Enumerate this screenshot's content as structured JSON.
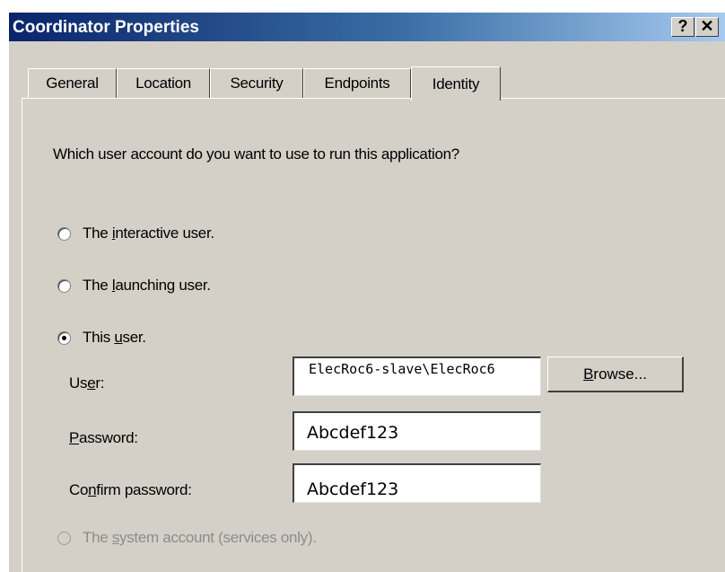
{
  "window": {
    "title": "Coordinator Properties",
    "help_label": "?",
    "close_label": "✕"
  },
  "tabs": [
    {
      "label": "General",
      "active": false
    },
    {
      "label": "Location",
      "active": false
    },
    {
      "label": "Security",
      "active": false
    },
    {
      "label": "Endpoints",
      "active": false
    },
    {
      "label": "Identity",
      "active": true
    }
  ],
  "identity": {
    "question": "Which user account do you want to use to run this application?",
    "options": [
      {
        "pre": "The ",
        "key": "i",
        "post": "nteractive user.",
        "selected": false,
        "enabled": true
      },
      {
        "pre": "The ",
        "key": "l",
        "post": "aunching user.",
        "selected": false,
        "enabled": true
      },
      {
        "pre": "This ",
        "key": "u",
        "post": "ser.",
        "selected": true,
        "enabled": true
      },
      {
        "pre": "The ",
        "key": "s",
        "post": "ystem account (services only).",
        "selected": false,
        "enabled": false
      }
    ],
    "user": {
      "label_pre": "Us",
      "label_key": "e",
      "label_post": "r:",
      "value": "ElecRoc6-slave\\ElecRoc6"
    },
    "browse": {
      "key": "B",
      "post": "rowse..."
    },
    "password": {
      "label_key": "P",
      "label_post": "assword:",
      "value": "Abcdef123"
    },
    "confirm_password": {
      "label_pre": "Co",
      "label_key": "n",
      "label_post": "firm password:",
      "value": "Abcdef123"
    }
  }
}
